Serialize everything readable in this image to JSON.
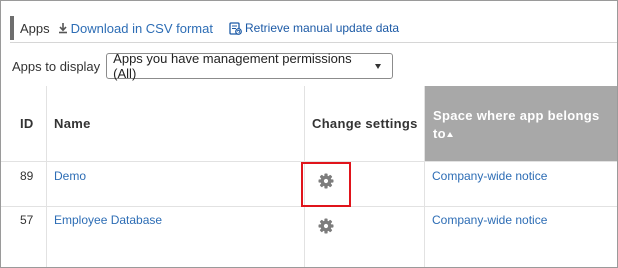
{
  "header": {
    "title": "Apps",
    "csv_label": "Download in CSV format",
    "retrieve_label": "Retrieve manual update data"
  },
  "filter": {
    "label": "Apps to display",
    "selected": "Apps you have management permissions (All)"
  },
  "table": {
    "columns": {
      "id": "ID",
      "name": "Name",
      "change": "Change settings",
      "space": "Space where app belongs to"
    },
    "rows": [
      {
        "id": "89",
        "name": "Demo",
        "space": "Company-wide notice"
      },
      {
        "id": "57",
        "name": "Employee Database",
        "space": "Company-wide notice"
      }
    ]
  },
  "colors": {
    "link": "#2d6db5",
    "sorted_header_bg": "#a8a8a8",
    "highlight": "#e0141b"
  },
  "icons": [
    "download-icon",
    "retrieve-data-icon",
    "gear-icon",
    "sort-ascending-icon",
    "dropdown-caret-icon"
  ]
}
